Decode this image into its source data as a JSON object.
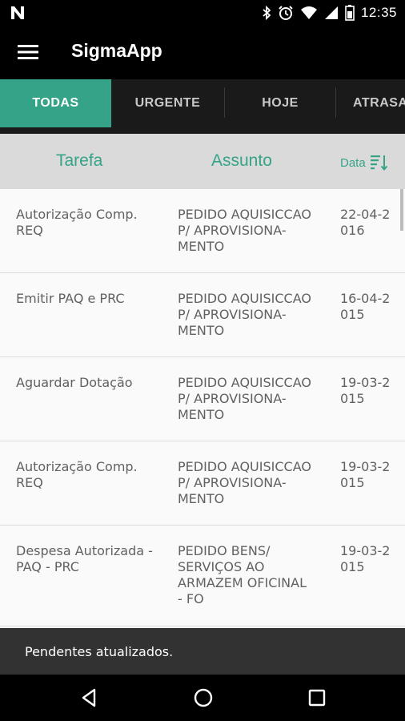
{
  "status_bar": {
    "time": "12:35",
    "icons": [
      "notification-n-icon",
      "bluetooth-icon",
      "alarm-icon",
      "wifi-icon",
      "cell-signal-icon",
      "battery-icon"
    ]
  },
  "toolbar": {
    "title": "SigmaApp",
    "menu_icon": "menu-icon"
  },
  "tabs": [
    {
      "label": "TODAS",
      "active": true
    },
    {
      "label": "URGENTE",
      "active": false
    },
    {
      "label": "HOJE",
      "active": false
    },
    {
      "label": "ATRASA",
      "active": false
    }
  ],
  "table": {
    "headers": {
      "tarefa": "Tarefa",
      "assunto": "Assunto",
      "data": "Data"
    },
    "sort_icon": "sort-icon",
    "rows": [
      {
        "tarefa": "Autorização Comp.\nREQ",
        "assunto": "PEDIDO AQUISICCAO\nP/ APROVISIONA-\nMENTO",
        "data": "22-04-2\n016"
      },
      {
        "tarefa": "Emitir PAQ e PRC",
        "assunto": "PEDIDO AQUISICCAO\nP/ APROVISIONA-\nMENTO",
        "data": "16-04-2\n015"
      },
      {
        "tarefa": "Aguardar Dotação",
        "assunto": "PEDIDO AQUISICCAO\nP/ APROVISIONA-\nMENTO",
        "data": "19-03-2\n015"
      },
      {
        "tarefa": "Autorização Comp.\nREQ",
        "assunto": "PEDIDO AQUISICCAO\nP/ APROVISIONA-\nMENTO",
        "data": "19-03-2\n015"
      },
      {
        "tarefa": "Despesa Autorizada -\nPAQ - PRC",
        "assunto": "PEDIDO BENS/\nSERVIÇOS AO\nARMAZEM OFICINAL\n- FO",
        "data": "19-03-2\n015"
      }
    ]
  },
  "snackbar": {
    "message": "Pendentes atualizados."
  },
  "nav_bar": {
    "buttons": [
      "back-icon",
      "home-icon",
      "recents-icon"
    ]
  },
  "colors": {
    "accent": "#35a387",
    "header_bg": "#dadada",
    "snackbar_bg": "#323232"
  }
}
